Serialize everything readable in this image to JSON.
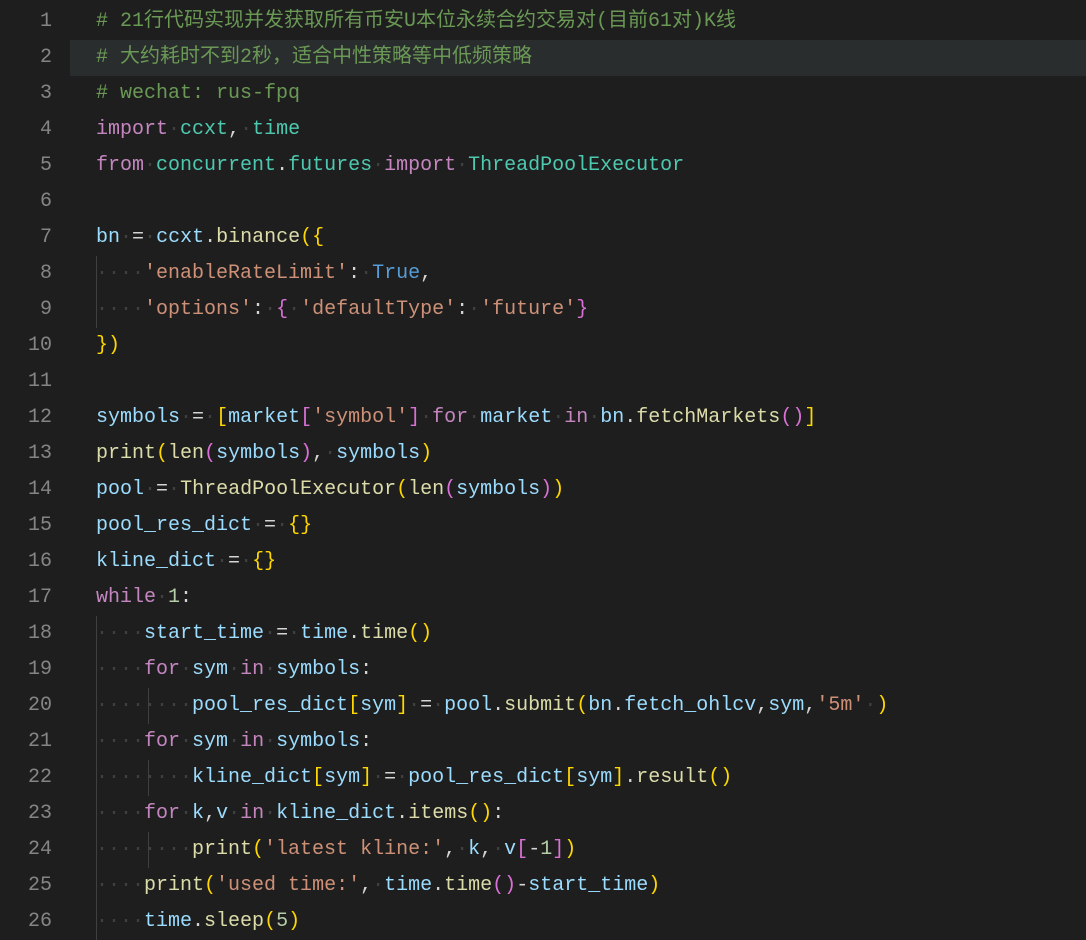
{
  "editor": {
    "highlighted_line": 2,
    "whitespace_glyph": "·",
    "indent_size": 4
  },
  "lines": [
    {
      "num": 1,
      "tokens": [
        {
          "t": "comment",
          "v": "# 21行代码实现并发获取所有币安U本位永续合约交易对(目前61对)K线"
        }
      ]
    },
    {
      "num": 2,
      "tokens": [
        {
          "t": "comment",
          "v": "# 大约耗时不到2秒，适合中性策略等中低频策略"
        }
      ]
    },
    {
      "num": 3,
      "tokens": [
        {
          "t": "comment",
          "v": "# wechat: rus-fpq"
        }
      ]
    },
    {
      "num": 4,
      "tokens": [
        {
          "t": "keyword",
          "v": "import"
        },
        {
          "t": "ws",
          "v": " "
        },
        {
          "t": "mod",
          "v": "ccxt"
        },
        {
          "t": "punct",
          "v": ","
        },
        {
          "t": "ws",
          "v": " "
        },
        {
          "t": "mod",
          "v": "time"
        }
      ]
    },
    {
      "num": 5,
      "tokens": [
        {
          "t": "keyword",
          "v": "from"
        },
        {
          "t": "ws",
          "v": " "
        },
        {
          "t": "mod",
          "v": "concurrent"
        },
        {
          "t": "punct",
          "v": "."
        },
        {
          "t": "mod",
          "v": "futures"
        },
        {
          "t": "ws",
          "v": " "
        },
        {
          "t": "keyword",
          "v": "import"
        },
        {
          "t": "ws",
          "v": " "
        },
        {
          "t": "mod",
          "v": "ThreadPoolExecutor"
        }
      ]
    },
    {
      "num": 6,
      "tokens": []
    },
    {
      "num": 7,
      "tokens": [
        {
          "t": "var",
          "v": "bn"
        },
        {
          "t": "ws",
          "v": " "
        },
        {
          "t": "op",
          "v": "="
        },
        {
          "t": "ws",
          "v": " "
        },
        {
          "t": "var",
          "v": "ccxt"
        },
        {
          "t": "punct",
          "v": "."
        },
        {
          "t": "func",
          "v": "binance"
        },
        {
          "t": "punct2",
          "v": "("
        },
        {
          "t": "punct2",
          "v": "{"
        }
      ]
    },
    {
      "num": 8,
      "indent": 1,
      "guides": [
        1
      ],
      "tokens": [
        {
          "t": "string",
          "v": "'enableRateLimit'"
        },
        {
          "t": "punct",
          "v": ":"
        },
        {
          "t": "ws",
          "v": " "
        },
        {
          "t": "const",
          "v": "True"
        },
        {
          "t": "punct",
          "v": ","
        }
      ]
    },
    {
      "num": 9,
      "indent": 1,
      "guides": [
        1
      ],
      "tokens": [
        {
          "t": "string",
          "v": "'options'"
        },
        {
          "t": "punct",
          "v": ":"
        },
        {
          "t": "ws",
          "v": " "
        },
        {
          "t": "punct3",
          "v": "{"
        },
        {
          "t": "ws",
          "v": " "
        },
        {
          "t": "string",
          "v": "'defaultType'"
        },
        {
          "t": "punct",
          "v": ":"
        },
        {
          "t": "ws",
          "v": " "
        },
        {
          "t": "string",
          "v": "'future'"
        },
        {
          "t": "punct3",
          "v": "}"
        }
      ]
    },
    {
      "num": 10,
      "tokens": [
        {
          "t": "punct2",
          "v": "}"
        },
        {
          "t": "punct2",
          "v": ")"
        }
      ]
    },
    {
      "num": 11,
      "tokens": []
    },
    {
      "num": 12,
      "tokens": [
        {
          "t": "var",
          "v": "symbols"
        },
        {
          "t": "ws",
          "v": " "
        },
        {
          "t": "op",
          "v": "="
        },
        {
          "t": "ws",
          "v": " "
        },
        {
          "t": "punct2",
          "v": "["
        },
        {
          "t": "var",
          "v": "market"
        },
        {
          "t": "punct3",
          "v": "["
        },
        {
          "t": "string",
          "v": "'symbol'"
        },
        {
          "t": "punct3",
          "v": "]"
        },
        {
          "t": "ws",
          "v": " "
        },
        {
          "t": "keyword",
          "v": "for"
        },
        {
          "t": "ws",
          "v": " "
        },
        {
          "t": "var",
          "v": "market"
        },
        {
          "t": "ws",
          "v": " "
        },
        {
          "t": "keyword",
          "v": "in"
        },
        {
          "t": "ws",
          "v": " "
        },
        {
          "t": "var",
          "v": "bn"
        },
        {
          "t": "punct",
          "v": "."
        },
        {
          "t": "func",
          "v": "fetchMarkets"
        },
        {
          "t": "punct3",
          "v": "("
        },
        {
          "t": "punct3",
          "v": ")"
        },
        {
          "t": "punct2",
          "v": "]"
        }
      ]
    },
    {
      "num": 13,
      "tokens": [
        {
          "t": "func",
          "v": "print"
        },
        {
          "t": "punct2",
          "v": "("
        },
        {
          "t": "func",
          "v": "len"
        },
        {
          "t": "punct3",
          "v": "("
        },
        {
          "t": "var",
          "v": "symbols"
        },
        {
          "t": "punct3",
          "v": ")"
        },
        {
          "t": "punct",
          "v": ","
        },
        {
          "t": "ws",
          "v": " "
        },
        {
          "t": "var",
          "v": "symbols"
        },
        {
          "t": "punct2",
          "v": ")"
        }
      ]
    },
    {
      "num": 14,
      "tokens": [
        {
          "t": "var",
          "v": "pool"
        },
        {
          "t": "ws",
          "v": " "
        },
        {
          "t": "op",
          "v": "="
        },
        {
          "t": "ws",
          "v": " "
        },
        {
          "t": "func",
          "v": "ThreadPoolExecutor"
        },
        {
          "t": "punct2",
          "v": "("
        },
        {
          "t": "func",
          "v": "len"
        },
        {
          "t": "punct3",
          "v": "("
        },
        {
          "t": "var",
          "v": "symbols"
        },
        {
          "t": "punct3",
          "v": ")"
        },
        {
          "t": "punct2",
          "v": ")"
        }
      ]
    },
    {
      "num": 15,
      "tokens": [
        {
          "t": "var",
          "v": "pool_res_dict"
        },
        {
          "t": "ws",
          "v": " "
        },
        {
          "t": "op",
          "v": "="
        },
        {
          "t": "ws",
          "v": " "
        },
        {
          "t": "punct2",
          "v": "{"
        },
        {
          "t": "punct2",
          "v": "}"
        }
      ]
    },
    {
      "num": 16,
      "tokens": [
        {
          "t": "var",
          "v": "kline_dict"
        },
        {
          "t": "ws",
          "v": " "
        },
        {
          "t": "op",
          "v": "="
        },
        {
          "t": "ws",
          "v": " "
        },
        {
          "t": "punct2",
          "v": "{"
        },
        {
          "t": "punct2",
          "v": "}"
        }
      ]
    },
    {
      "num": 17,
      "tokens": [
        {
          "t": "keyword",
          "v": "while"
        },
        {
          "t": "ws",
          "v": " "
        },
        {
          "t": "number",
          "v": "1"
        },
        {
          "t": "punct",
          "v": ":"
        }
      ]
    },
    {
      "num": 18,
      "indent": 1,
      "guides": [
        1
      ],
      "tokens": [
        {
          "t": "var",
          "v": "start_time"
        },
        {
          "t": "ws",
          "v": " "
        },
        {
          "t": "op",
          "v": "="
        },
        {
          "t": "ws",
          "v": " "
        },
        {
          "t": "var",
          "v": "time"
        },
        {
          "t": "punct",
          "v": "."
        },
        {
          "t": "func",
          "v": "time"
        },
        {
          "t": "punct2",
          "v": "("
        },
        {
          "t": "punct2",
          "v": ")"
        }
      ]
    },
    {
      "num": 19,
      "indent": 1,
      "guides": [
        1
      ],
      "tokens": [
        {
          "t": "keyword",
          "v": "for"
        },
        {
          "t": "ws",
          "v": " "
        },
        {
          "t": "var",
          "v": "sym"
        },
        {
          "t": "ws",
          "v": " "
        },
        {
          "t": "keyword",
          "v": "in"
        },
        {
          "t": "ws",
          "v": " "
        },
        {
          "t": "var",
          "v": "symbols"
        },
        {
          "t": "punct",
          "v": ":"
        }
      ]
    },
    {
      "num": 20,
      "indent": 2,
      "guides": [
        1,
        2
      ],
      "tokens": [
        {
          "t": "var",
          "v": "pool_res_dict"
        },
        {
          "t": "punct2",
          "v": "["
        },
        {
          "t": "var",
          "v": "sym"
        },
        {
          "t": "punct2",
          "v": "]"
        },
        {
          "t": "ws",
          "v": " "
        },
        {
          "t": "op",
          "v": "="
        },
        {
          "t": "ws",
          "v": " "
        },
        {
          "t": "var",
          "v": "pool"
        },
        {
          "t": "punct",
          "v": "."
        },
        {
          "t": "func",
          "v": "submit"
        },
        {
          "t": "punct2",
          "v": "("
        },
        {
          "t": "var",
          "v": "bn"
        },
        {
          "t": "punct",
          "v": "."
        },
        {
          "t": "var",
          "v": "fetch_ohlcv"
        },
        {
          "t": "punct",
          "v": ","
        },
        {
          "t": "var",
          "v": "sym"
        },
        {
          "t": "punct",
          "v": ","
        },
        {
          "t": "string",
          "v": "'5m'"
        },
        {
          "t": "ws",
          "v": " "
        },
        {
          "t": "punct2",
          "v": ")"
        }
      ]
    },
    {
      "num": 21,
      "indent": 1,
      "guides": [
        1
      ],
      "tokens": [
        {
          "t": "keyword",
          "v": "for"
        },
        {
          "t": "ws",
          "v": " "
        },
        {
          "t": "var",
          "v": "sym"
        },
        {
          "t": "ws",
          "v": " "
        },
        {
          "t": "keyword",
          "v": "in"
        },
        {
          "t": "ws",
          "v": " "
        },
        {
          "t": "var",
          "v": "symbols"
        },
        {
          "t": "punct",
          "v": ":"
        }
      ]
    },
    {
      "num": 22,
      "indent": 2,
      "guides": [
        1,
        2
      ],
      "tokens": [
        {
          "t": "var",
          "v": "kline_dict"
        },
        {
          "t": "punct2",
          "v": "["
        },
        {
          "t": "var",
          "v": "sym"
        },
        {
          "t": "punct2",
          "v": "]"
        },
        {
          "t": "ws",
          "v": " "
        },
        {
          "t": "op",
          "v": "="
        },
        {
          "t": "ws",
          "v": " "
        },
        {
          "t": "var",
          "v": "pool_res_dict"
        },
        {
          "t": "punct2",
          "v": "["
        },
        {
          "t": "var",
          "v": "sym"
        },
        {
          "t": "punct2",
          "v": "]"
        },
        {
          "t": "punct",
          "v": "."
        },
        {
          "t": "func",
          "v": "result"
        },
        {
          "t": "punct2",
          "v": "("
        },
        {
          "t": "punct2",
          "v": ")"
        }
      ]
    },
    {
      "num": 23,
      "indent": 1,
      "guides": [
        1
      ],
      "tokens": [
        {
          "t": "keyword",
          "v": "for"
        },
        {
          "t": "ws",
          "v": " "
        },
        {
          "t": "var",
          "v": "k"
        },
        {
          "t": "punct",
          "v": ","
        },
        {
          "t": "var",
          "v": "v"
        },
        {
          "t": "ws",
          "v": " "
        },
        {
          "t": "keyword",
          "v": "in"
        },
        {
          "t": "ws",
          "v": " "
        },
        {
          "t": "var",
          "v": "kline_dict"
        },
        {
          "t": "punct",
          "v": "."
        },
        {
          "t": "func",
          "v": "items"
        },
        {
          "t": "punct2",
          "v": "("
        },
        {
          "t": "punct2",
          "v": ")"
        },
        {
          "t": "punct",
          "v": ":"
        }
      ]
    },
    {
      "num": 24,
      "indent": 2,
      "guides": [
        1,
        2
      ],
      "tokens": [
        {
          "t": "func",
          "v": "print"
        },
        {
          "t": "punct2",
          "v": "("
        },
        {
          "t": "string",
          "v": "'latest kline:'"
        },
        {
          "t": "punct",
          "v": ","
        },
        {
          "t": "ws",
          "v": " "
        },
        {
          "t": "var",
          "v": "k"
        },
        {
          "t": "punct",
          "v": ","
        },
        {
          "t": "ws",
          "v": " "
        },
        {
          "t": "var",
          "v": "v"
        },
        {
          "t": "punct3",
          "v": "["
        },
        {
          "t": "op",
          "v": "-"
        },
        {
          "t": "number",
          "v": "1"
        },
        {
          "t": "punct3",
          "v": "]"
        },
        {
          "t": "punct2",
          "v": ")"
        }
      ]
    },
    {
      "num": 25,
      "indent": 1,
      "guides": [
        1
      ],
      "tokens": [
        {
          "t": "func",
          "v": "print"
        },
        {
          "t": "punct2",
          "v": "("
        },
        {
          "t": "string",
          "v": "'used time:'"
        },
        {
          "t": "punct",
          "v": ","
        },
        {
          "t": "ws",
          "v": " "
        },
        {
          "t": "var",
          "v": "time"
        },
        {
          "t": "punct",
          "v": "."
        },
        {
          "t": "func",
          "v": "time"
        },
        {
          "t": "punct3",
          "v": "("
        },
        {
          "t": "punct3",
          "v": ")"
        },
        {
          "t": "op",
          "v": "-"
        },
        {
          "t": "var",
          "v": "start_time"
        },
        {
          "t": "punct2",
          "v": ")"
        }
      ]
    },
    {
      "num": 26,
      "indent": 1,
      "guides": [
        1
      ],
      "tokens": [
        {
          "t": "var",
          "v": "time"
        },
        {
          "t": "punct",
          "v": "."
        },
        {
          "t": "func",
          "v": "sleep"
        },
        {
          "t": "punct2",
          "v": "("
        },
        {
          "t": "number",
          "v": "5"
        },
        {
          "t": "punct2",
          "v": ")"
        }
      ]
    }
  ]
}
